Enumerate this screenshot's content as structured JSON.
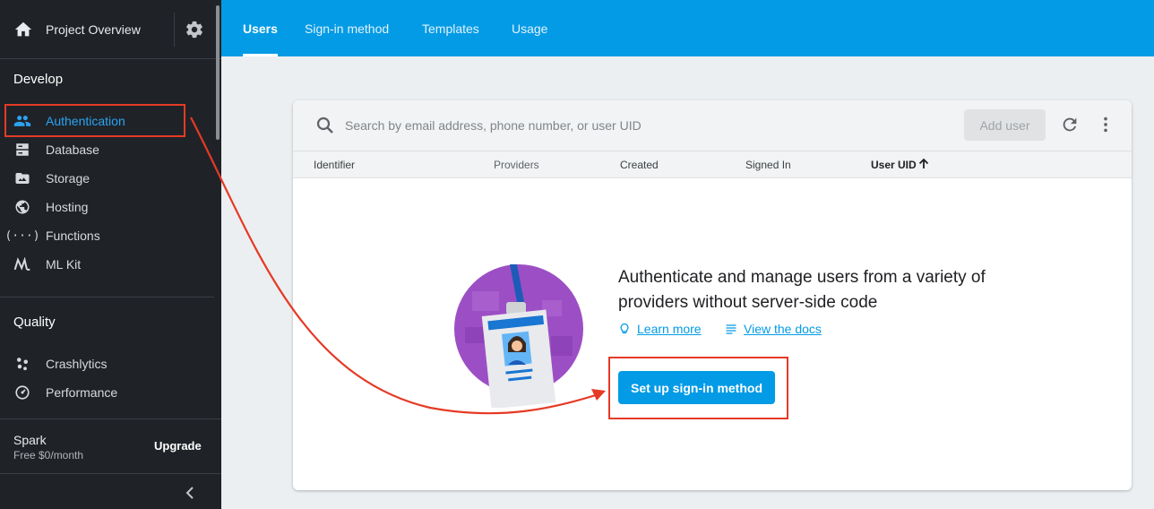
{
  "sidebar": {
    "header_title": "Project Overview",
    "sections": [
      {
        "title": "Develop",
        "items": [
          {
            "label": "Authentication",
            "icon": "people-icon",
            "active": true
          },
          {
            "label": "Database",
            "icon": "database-icon"
          },
          {
            "label": "Storage",
            "icon": "storage-icon"
          },
          {
            "label": "Hosting",
            "icon": "hosting-icon"
          },
          {
            "label": "Functions",
            "icon": "functions-icon"
          },
          {
            "label": "ML Kit",
            "icon": "mlkit-icon"
          }
        ]
      },
      {
        "title": "Quality",
        "items": [
          {
            "label": "Crashlytics",
            "icon": "crashlytics-icon"
          },
          {
            "label": "Performance",
            "icon": "performance-icon"
          }
        ]
      }
    ],
    "plan": {
      "name": "Spark",
      "price": "Free $0/month",
      "upgrade_label": "Upgrade"
    }
  },
  "tabs": [
    {
      "label": "Users",
      "active": true
    },
    {
      "label": "Sign-in method"
    },
    {
      "label": "Templates"
    },
    {
      "label": "Usage"
    }
  ],
  "search": {
    "placeholder": "Search by email address, phone number, or user UID"
  },
  "add_user_label": "Add user",
  "columns": [
    "Identifier",
    "Providers",
    "Created",
    "Signed In",
    "User UID"
  ],
  "empty_state": {
    "title": "Authenticate and manage users from a variety of providers without server-side code",
    "learn_more": "Learn more",
    "view_docs": "View the docs",
    "button": "Set up sign-in method"
  },
  "colors": {
    "accent": "#039be5",
    "sidebar_bg": "#1f2328",
    "annotation": "#e53a25",
    "active_item": "#2ba4f2"
  }
}
